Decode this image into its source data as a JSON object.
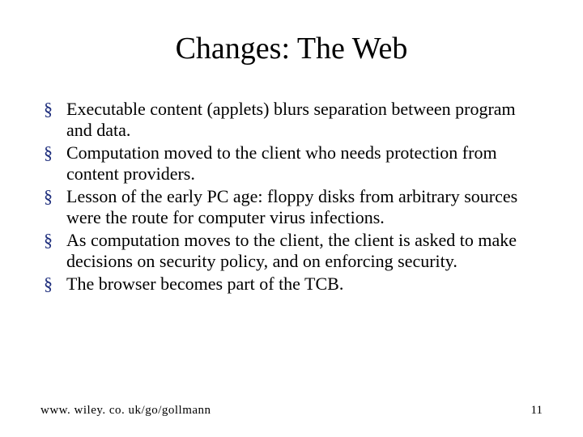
{
  "title": "Changes: The Web",
  "bullets": [
    "Executable content (applets) blurs separation between program and data.",
    "Computation moved to the client who needs protection from content providers.",
    "Lesson of the early PC age: floppy disks from arbitrary sources were the route for computer virus infections.",
    "As computation moves to the client, the client is asked to make decisions on security policy, and on enforcing security.",
    "The browser becomes part of the TCB."
  ],
  "footer": {
    "url": "www. wiley. co. uk/go/gollmann",
    "page": "11"
  }
}
